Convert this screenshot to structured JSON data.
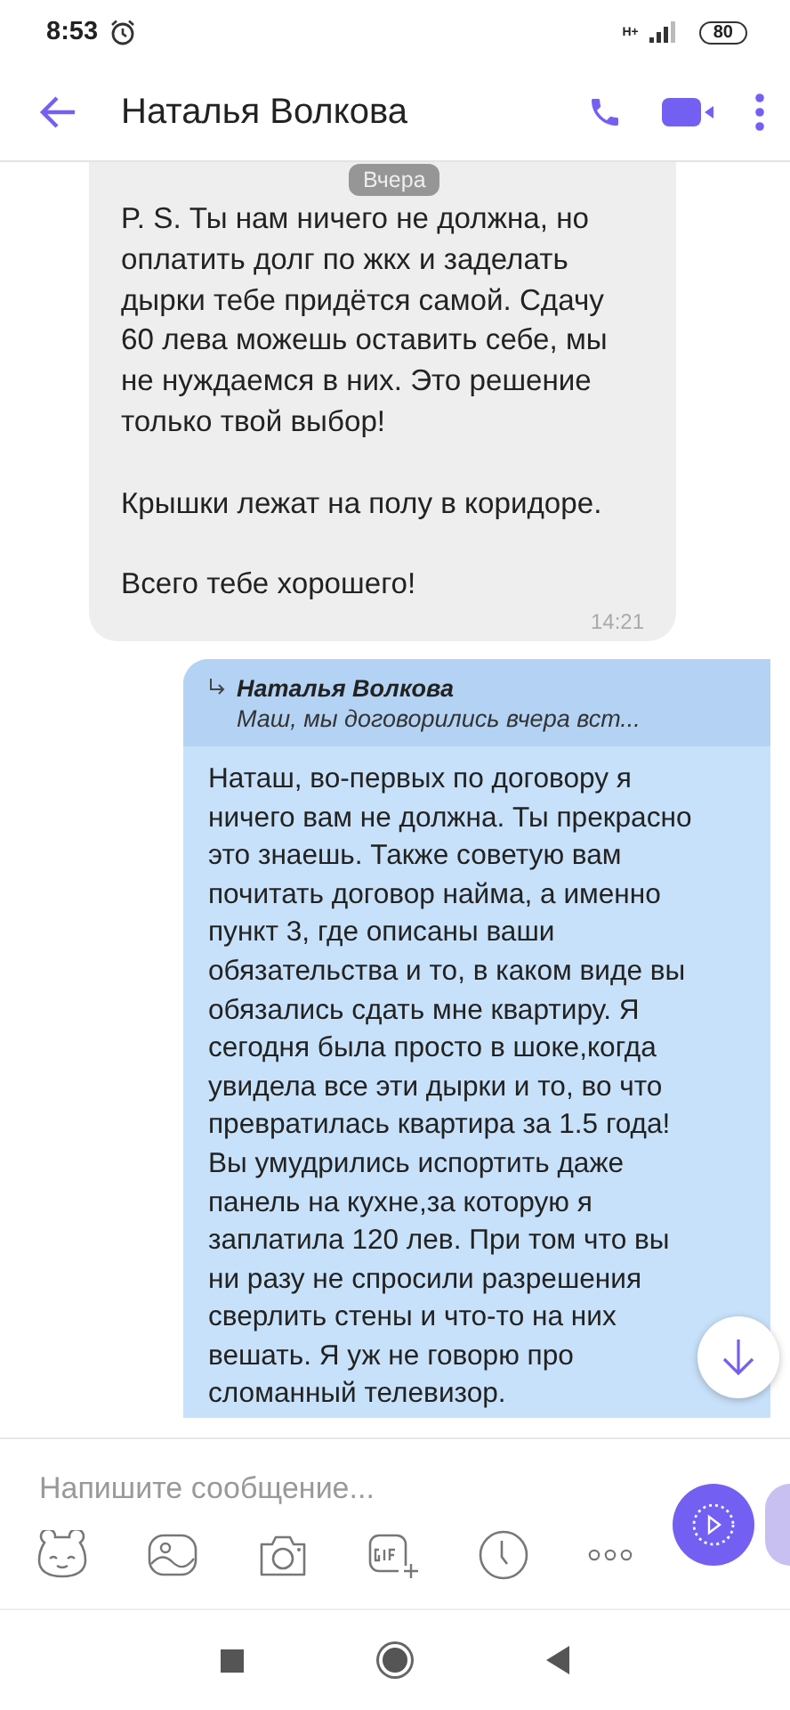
{
  "status_bar": {
    "time": "8:53",
    "network": "H+",
    "battery": "80"
  },
  "header": {
    "title": "Наталья Волкова"
  },
  "date_chip": "Вчера",
  "messages": [
    {
      "kind": "incoming",
      "text": "P. S. Ты нам ничего не должна, но оплатить долг по жкх и заделать дырки тебе придётся самой. Сдачу 60 лева можешь оставить себе, мы не нуждаемся в них. Это решение только твой выбор!\n\nКрышки лежат на полу в коридоре.\n\nВсего тебе хорошего!",
      "time": "14:21"
    },
    {
      "kind": "outgoing",
      "reply": {
        "author": "Наталья Волкова",
        "text": "Маш, мы договорились вчера вст..."
      },
      "text": "Наташ, во-первых по договору я ничего вам не должна. Ты прекрасно это знаешь. Также советую вам почитать договор найма, а именно пункт 3, где описаны ваши обязательства и то, в каком виде вы обязались сдать мне квартиру. Я сегодня была просто в шоке,когда увидела все эти дырки и то, во что превратилась квартира за 1.5 года! Вы умудрились испортить даже панель на кухне,за которую я заплатила 120 лев. При том что вы ни разу не спросили разрешения сверлить стены и что-то на них вешать. Я уж не говорю про сломанный телевизор."
    }
  ],
  "composer": {
    "placeholder": "Напишите сообщение..."
  }
}
